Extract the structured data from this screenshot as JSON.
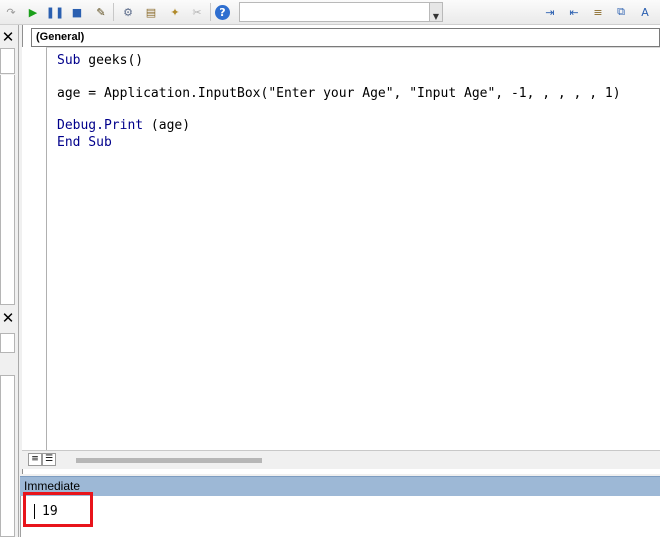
{
  "toolbar": {
    "buttons": [
      {
        "name": "redo-icon",
        "glyph": "↷",
        "color": "#9a9a9a"
      },
      {
        "name": "run-icon",
        "glyph": "▶",
        "color": "#1a9f1a"
      },
      {
        "name": "pause-icon",
        "glyph": "❚❚",
        "color": "#2a5fb0"
      },
      {
        "name": "reset-icon",
        "glyph": "■",
        "color": "#2a5fb0"
      },
      {
        "name": "design-mode-icon",
        "glyph": "✎",
        "color": "#5a4a1a"
      },
      {
        "name": "project-explorer-icon",
        "glyph": "⚙",
        "color": "#5b6b8a"
      },
      {
        "name": "properties-icon",
        "glyph": "▤",
        "color": "#8a6a2a"
      },
      {
        "name": "object-browser-icon",
        "glyph": "✦",
        "color": "#b08a2a"
      },
      {
        "name": "toolbox-icon",
        "glyph": "✂",
        "color": "#b0b0b0"
      },
      {
        "name": "help-icon",
        "glyph": "?",
        "color": "#ffffff"
      }
    ],
    "right_buttons": [
      {
        "name": "indent-icon",
        "glyph": "⇥",
        "color": "#2a5fb0"
      },
      {
        "name": "outdent-icon",
        "glyph": "⇤",
        "color": "#2a5fb0"
      },
      {
        "name": "toggle-breakpoint-icon",
        "glyph": "≡",
        "color": "#8a6a2a"
      },
      {
        "name": "comment-block-icon",
        "glyph": "⧉",
        "color": "#2a5fb0"
      },
      {
        "name": "complete-word-icon",
        "glyph": "A",
        "color": "#2a5fb0"
      }
    ]
  },
  "left_panel": {
    "close_glyph": "✕"
  },
  "code_window": {
    "object_combo": "(General)",
    "lines": [
      {
        "kw": "Sub",
        "rest": " geeks()"
      },
      {
        "kw": "",
        "rest": ""
      },
      {
        "kw": "",
        "rest": "age = Application.InputBox(\"Enter your Age\", \"Input Age\", -1, , , , , 1)"
      },
      {
        "kw": "",
        "rest": ""
      },
      {
        "kw": "Debug.Print",
        "rest": " (age)"
      },
      {
        "kw": "End Sub",
        "rest": ""
      }
    ]
  },
  "immediate": {
    "title": "Immediate",
    "output": "19"
  },
  "colors": {
    "keyword": "#00008b",
    "immediate_title_bg": "#9db8d6",
    "highlight": "#e8141b"
  }
}
